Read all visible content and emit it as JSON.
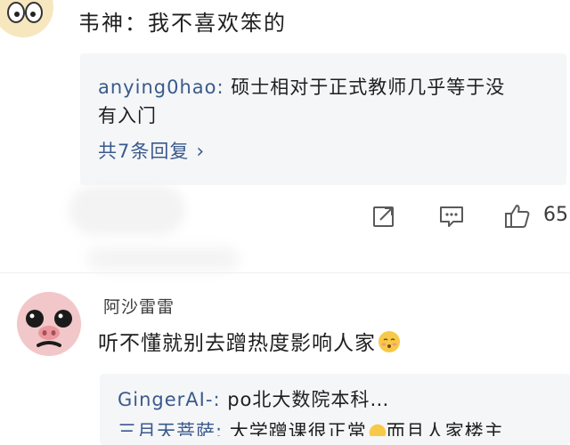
{
  "comment1": {
    "text": "韦神：我不喜欢笨的",
    "reply": {
      "user": "anying0hao",
      "separator": ": ",
      "text_line1": "硕士相对于正式教师几乎等于没",
      "text_line2": "有入门"
    },
    "more_replies": "共7条回复",
    "more_chevron": "›",
    "actions": {
      "share_icon": "share-icon",
      "comment_icon": "comment-icon",
      "like_icon": "thumbs-up-icon",
      "like_count": "65"
    }
  },
  "comment2": {
    "username": "阿沙雷雷",
    "text": "听不懂就别去蹭热度影响人家",
    "emoji": "blush-emoji",
    "replies": [
      {
        "user": "GingerAI-",
        "separator": ": ",
        "text": "po北大数院本科…"
      },
      {
        "user": "三月天菩萨",
        "separator": ": ",
        "text": "大学蹭课很正常",
        "text_after": "而且人家楼主"
      }
    ]
  },
  "colors": {
    "link": "#3a5a8c",
    "reply_bg": "#f5f6f8",
    "text": "#1f1f1f"
  }
}
